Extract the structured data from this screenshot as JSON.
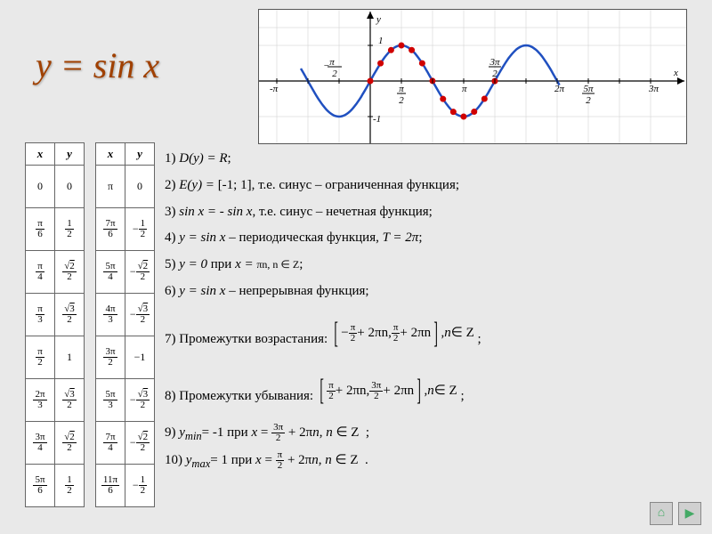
{
  "title": "y = sin x",
  "table1_headers": [
    "x",
    "y"
  ],
  "table1": [
    {
      "x": "0",
      "y": "0"
    },
    {
      "x": "π/6",
      "y": "1/2"
    },
    {
      "x": "π/4",
      "y": "√2/2"
    },
    {
      "x": "π/3",
      "y": "√3/2"
    },
    {
      "x": "π/2",
      "y": "1"
    },
    {
      "x": "2π/3",
      "y": "√3/2"
    },
    {
      "x": "3π/4",
      "y": "√2/2"
    },
    {
      "x": "5π/6",
      "y": "1/2"
    }
  ],
  "table2_headers": [
    "x",
    "y"
  ],
  "table2": [
    {
      "x": "π",
      "y": "0"
    },
    {
      "x": "7π/6",
      "y": "−1/2"
    },
    {
      "x": "5π/4",
      "y": "−√2/2"
    },
    {
      "x": "4π/3",
      "y": "−√3/2"
    },
    {
      "x": "3π/2",
      "y": "-1"
    },
    {
      "x": "5π/3",
      "y": "−√3/2"
    },
    {
      "x": "7π/4",
      "y": "−√2/2"
    },
    {
      "x": "11π/6",
      "y": "−1/2"
    }
  ],
  "props": {
    "p1_a": "1) ",
    "p1_b": "D(y) = R",
    "p1_c": ";",
    "p2_a": "2) ",
    "p2_b": "E(y) = ",
    "p2_c": "[-1; 1]",
    "p2_d": ", т.е. синус – ограниченная функция;",
    "p3_a": "3) ",
    "p3_b": "sin x = - sin x",
    "p3_c": ", т.е. синус – нечетная функция;",
    "p4_a": "4) ",
    "p4_b": "y = sin x",
    "p4_c": " – периодическая функция, ",
    "p4_d": "T = 2π",
    "p4_e": ";",
    "p5_a": "5) ",
    "p5_b": "y = 0",
    "p5_c": " при ",
    "p5_d": "x = ",
    "p5_e": "πn, n ∈ Z",
    "p5_f": ";",
    "p6_a": "6) ",
    "p6_b": "y = sin x",
    "p6_c": " – непрерывная функция;",
    "p7_a": "7) Промежутки возрастания: ",
    "p7_int": "[−π/2 + 2πn, π/2 + 2πn], n ∈ Z",
    "p8_a": "8) Промежутки убывания: ",
    "p8_int": "[π/2 + 2πn, 3π/2 + 2πn], n ∈ Z",
    "p9_a": "9) ",
    "p9_b": "y",
    "p9_c": "min",
    "p9_d": "= -1 при ",
    "p9_e": "x = 3π/2 + 2πn, n ∈ Z",
    "p10_a": "10) ",
    "p10_b": "y",
    "p10_c": "max",
    "p10_d": "= 1 при ",
    "p10_e": "x = π/2 + 2πn, n ∈ Z"
  },
  "chart_data": {
    "type": "line",
    "title": "y = sin x",
    "xlabel": "x",
    "ylabel": "y",
    "x_ticks": [
      "-π",
      "-π/2",
      "π/2",
      "π",
      "3π/2",
      "2π",
      "5π/2",
      "3π"
    ],
    "y_ticks": [
      "-1",
      "1"
    ],
    "xlim": [
      -3.6,
      9.8
    ],
    "ylim": [
      -1.3,
      1.3
    ],
    "series": [
      {
        "name": "sin x",
        "x": [
          -3.14,
          -2.62,
          -2.09,
          -1.57,
          -1.05,
          -0.52,
          0,
          0.52,
          1.05,
          1.57,
          2.09,
          2.62,
          3.14,
          3.67,
          4.19,
          4.71,
          5.24,
          5.76,
          6.28,
          6.81,
          7.33,
          7.85,
          8.38,
          8.9,
          9.42
        ],
        "y": [
          0,
          -0.5,
          -0.87,
          -1,
          -0.87,
          -0.5,
          0,
          0.5,
          0.87,
          1,
          0.87,
          0.5,
          0,
          -0.5,
          -0.87,
          -1,
          -0.87,
          -0.5,
          0,
          0.5,
          0.87,
          1,
          0.87,
          0.5,
          0
        ]
      }
    ],
    "marker_points_x": [
      0,
      0.52,
      1.05,
      1.57,
      2.09,
      2.62,
      3.14,
      3.67,
      4.19,
      4.71,
      5.24,
      5.76,
      6.28
    ]
  },
  "nav": {
    "home": "⌂",
    "next": "▶"
  }
}
